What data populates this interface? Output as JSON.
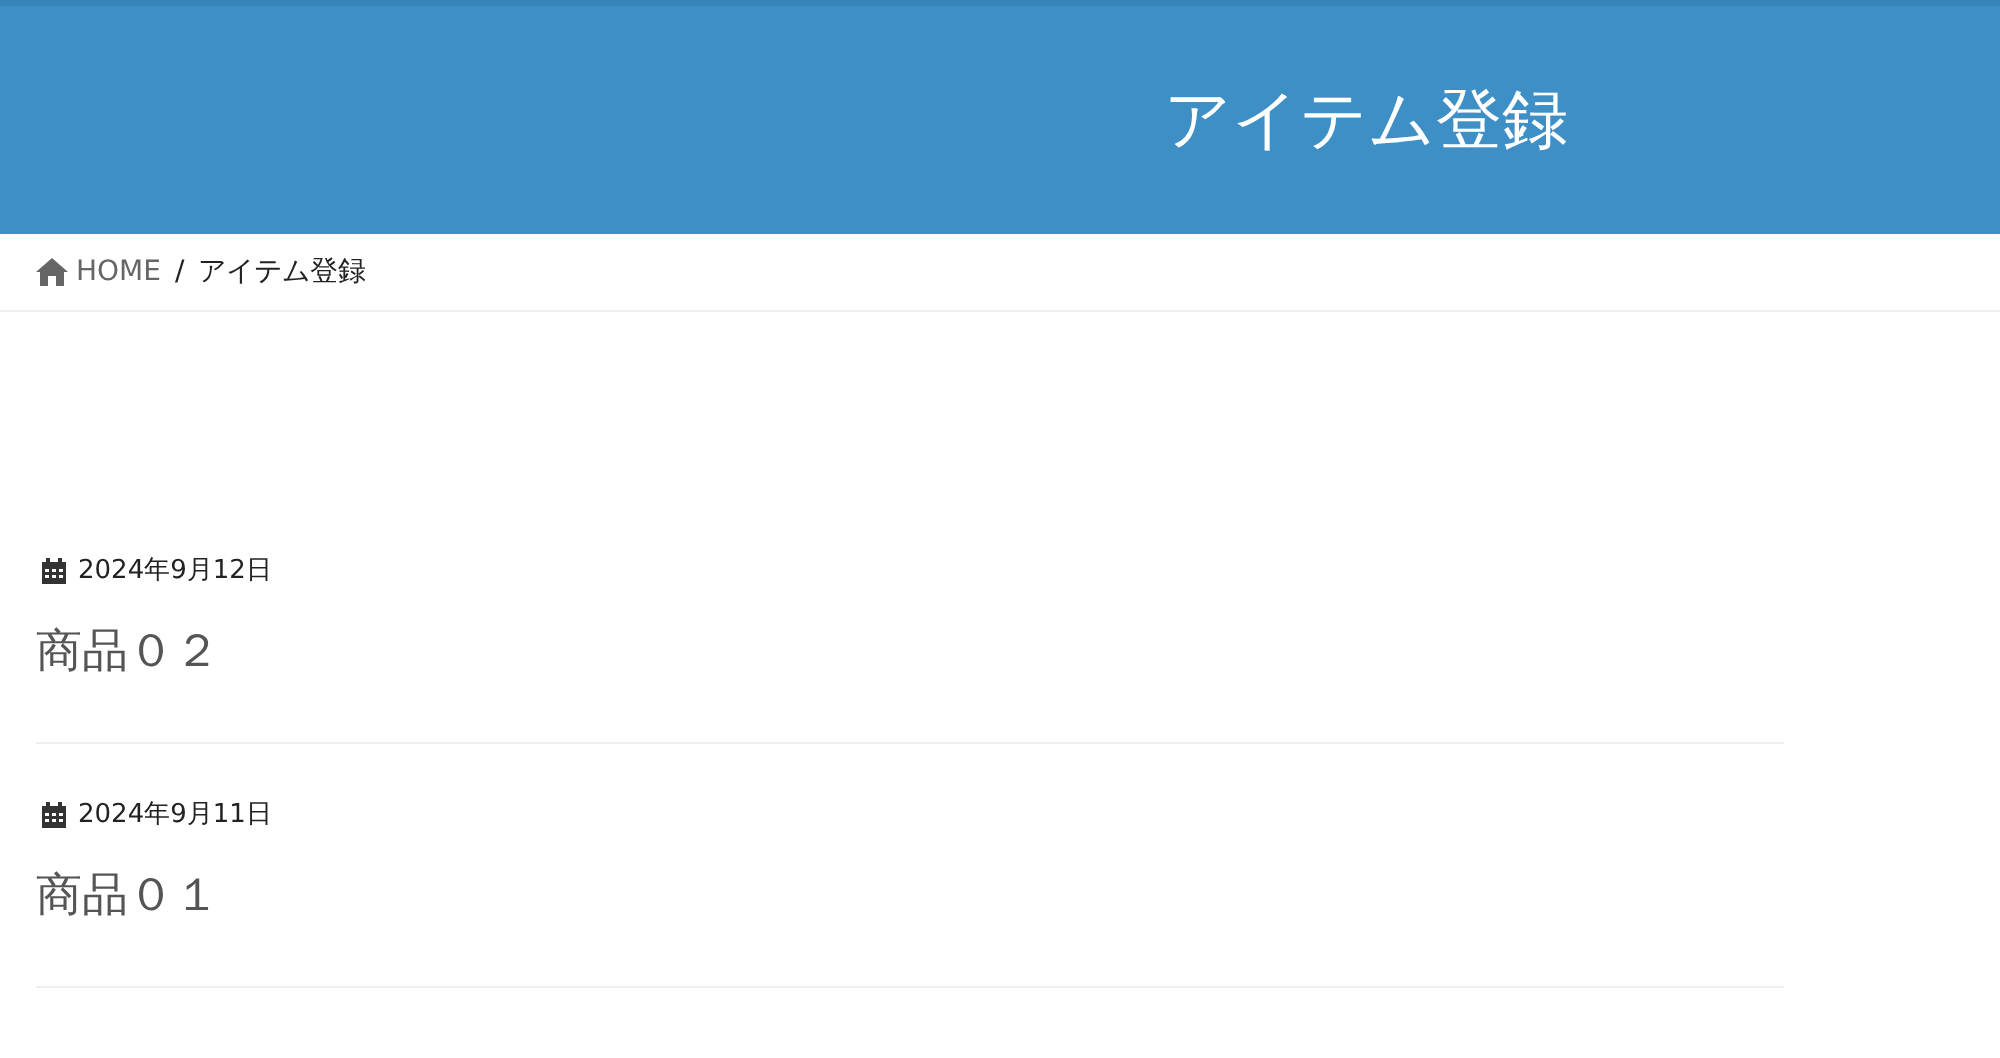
{
  "header": {
    "title": "アイテム登録"
  },
  "breadcrumb": [
    {
      "label": "HOME",
      "kind": "home"
    },
    {
      "label": "/",
      "kind": "separator"
    },
    {
      "label": "アイテム登録",
      "kind": "current"
    }
  ],
  "posts": [
    {
      "date": "2024年9月12日",
      "title": "商品０２"
    },
    {
      "date": "2024年9月11日",
      "title": "商品０１"
    }
  ]
}
